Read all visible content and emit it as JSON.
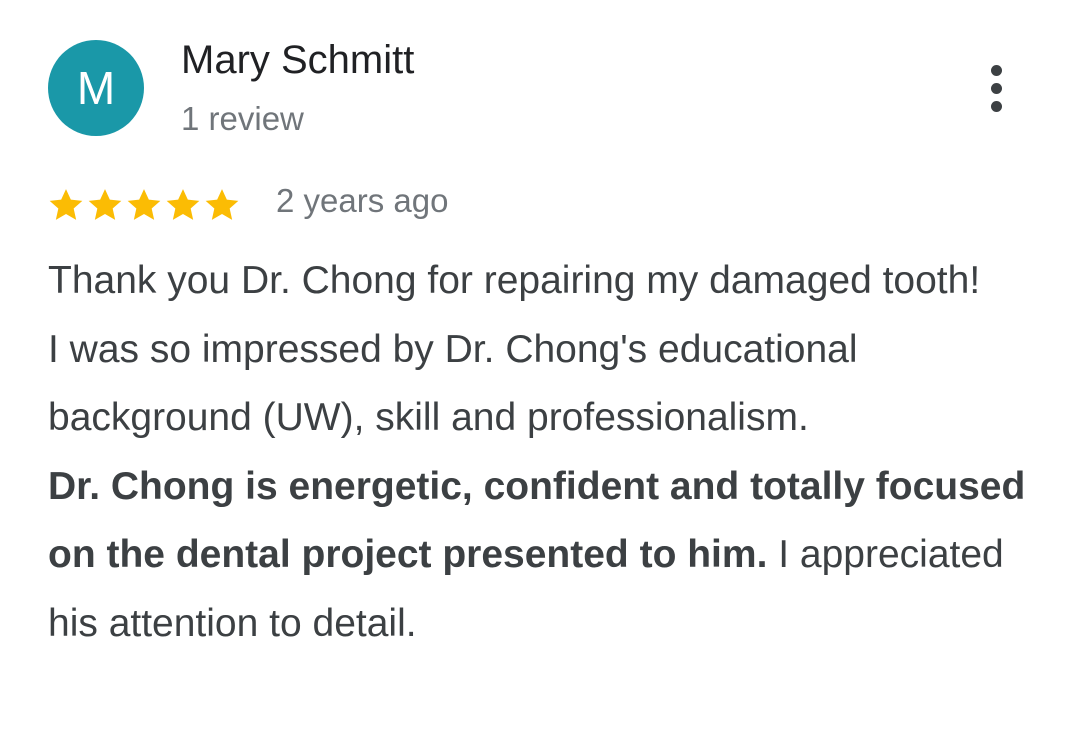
{
  "author": {
    "initial": "M",
    "name": "Mary Schmitt",
    "review_count": "1 review",
    "avatar_color": "#1a98a8"
  },
  "menu": {
    "icon": "more-vert-icon"
  },
  "rating": {
    "stars": 5,
    "max_stars": 5,
    "star_color": "#fbbc04",
    "icon": "star-icon"
  },
  "review": {
    "date": "2 years ago",
    "para1": "Thank you Dr. Chong for repairing my damaged tooth!",
    "para2": "I was so impressed by Dr. Chong's educational background (UW), skill and professionalism.",
    "para3_bold": "Dr. Chong is energetic, confident and totally focused on the dental project presented to him.",
    "para3_rest": " I appreciated his attention to detail."
  }
}
